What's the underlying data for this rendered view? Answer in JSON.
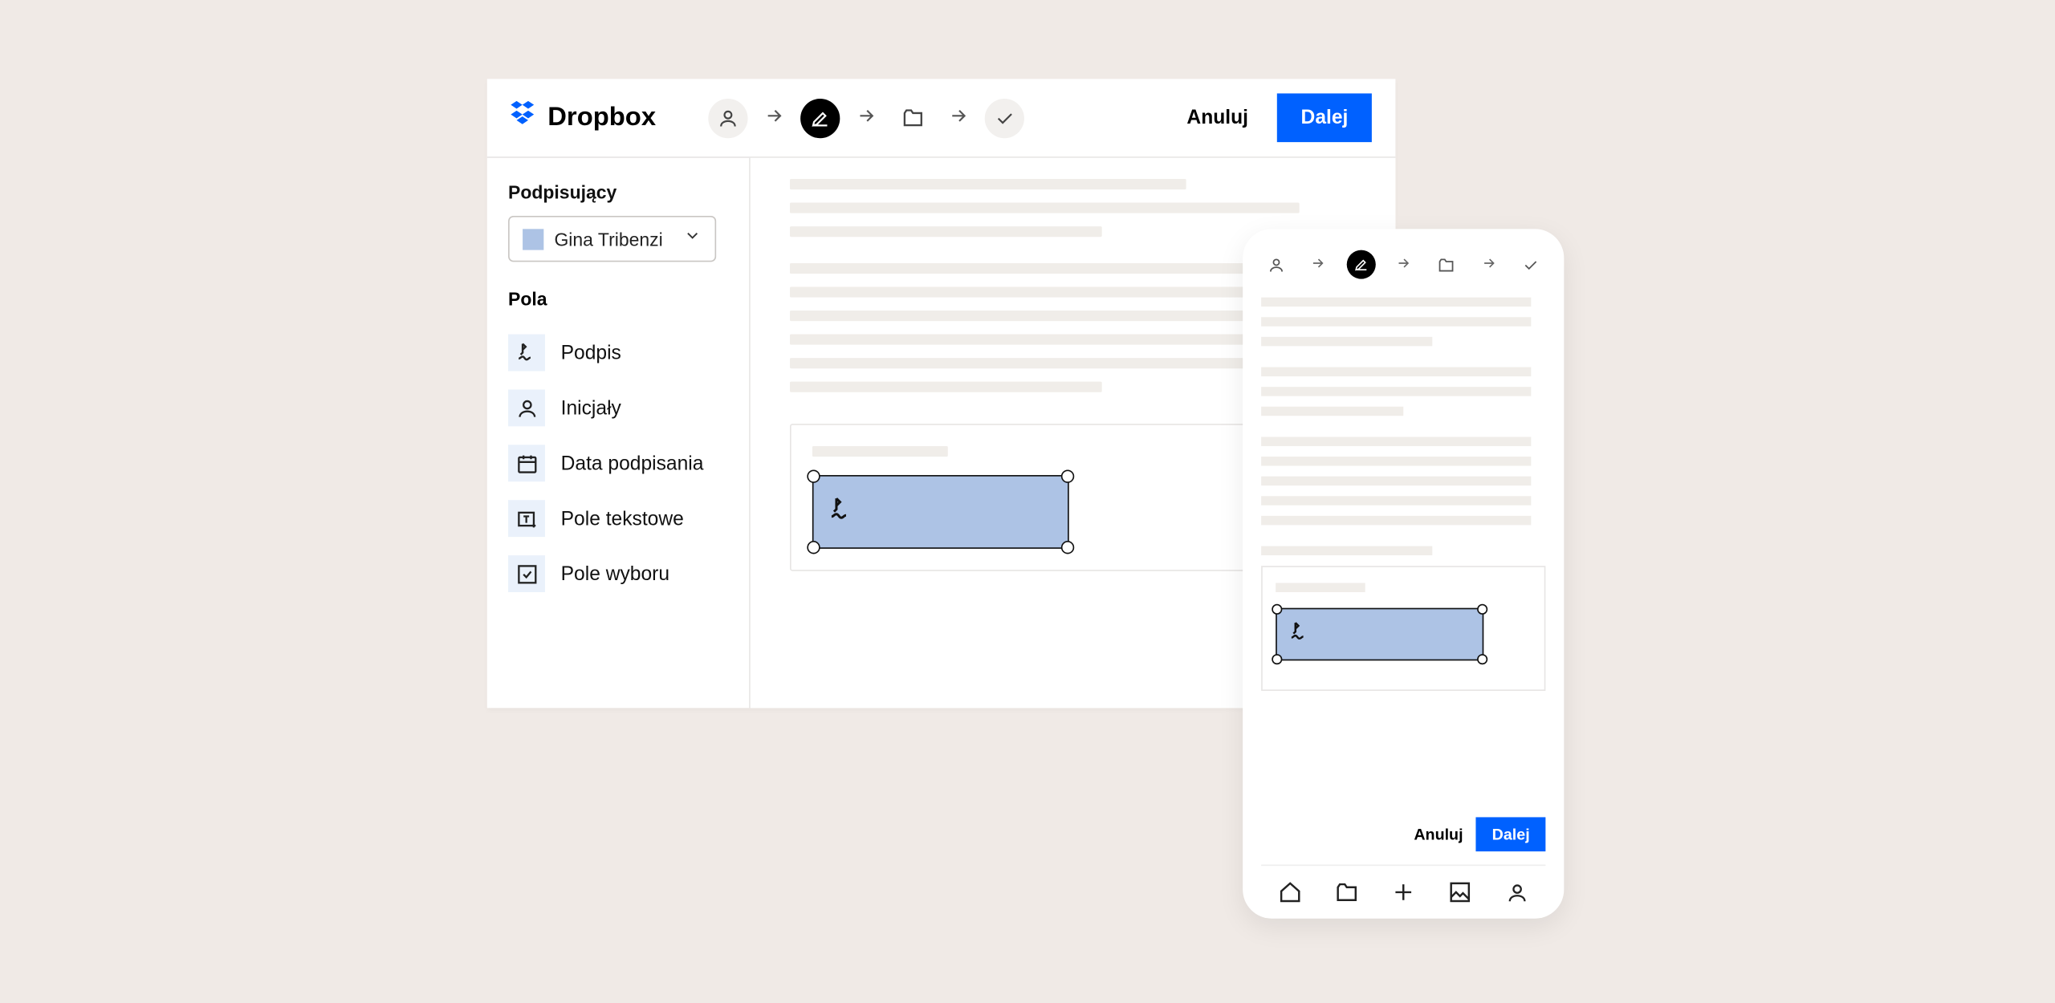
{
  "header": {
    "brand": "Dropbox",
    "cancel_label": "Anuluj",
    "next_label": "Dalej",
    "steps": [
      {
        "icon": "person",
        "active": false
      },
      {
        "icon": "edit",
        "active": true
      },
      {
        "icon": "folder",
        "active": false
      },
      {
        "icon": "check",
        "active": false
      }
    ]
  },
  "sidebar": {
    "signers_label": "Podpisujący",
    "signer": {
      "name": "Gina Tribenzi",
      "swatch_color": "#adc3e5"
    },
    "fields_label": "Pola",
    "fields": [
      {
        "id": "signature",
        "label": "Podpis",
        "icon": "signature"
      },
      {
        "id": "initials",
        "label": "Inicjały",
        "icon": "person"
      },
      {
        "id": "date",
        "label": "Data podpisania",
        "icon": "calendar"
      },
      {
        "id": "text",
        "label": "Pole tekstowe",
        "icon": "textbox"
      },
      {
        "id": "checkbox",
        "label": "Pole wyboru",
        "icon": "checkbox"
      }
    ]
  },
  "document": {
    "placed_field": {
      "type": "signature",
      "swatch_color": "#adc3e5"
    }
  },
  "mobile": {
    "cancel_label": "Anuluj",
    "next_label": "Dalej",
    "nav_icons": [
      "home",
      "folder",
      "plus",
      "photo",
      "person"
    ]
  },
  "colors": {
    "accent": "#0061ff",
    "signer_swatch": "#adc3e5",
    "placeholder": "#f0ede9"
  }
}
